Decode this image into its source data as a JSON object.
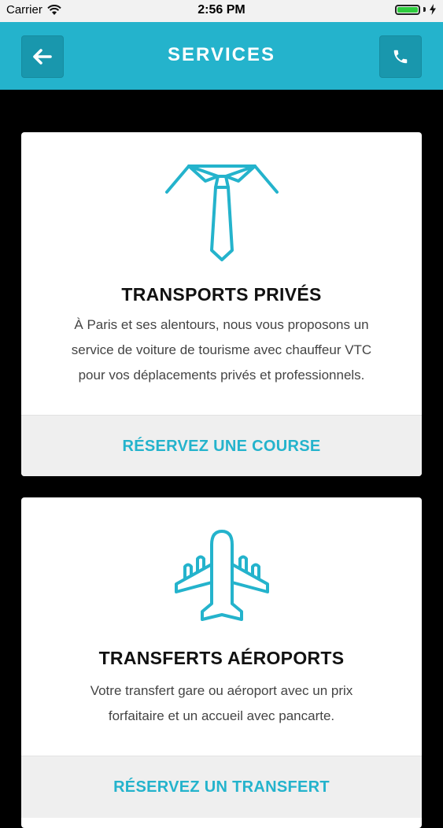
{
  "status_bar": {
    "carrier": "Carrier",
    "time": "2:56 PM",
    "battery_level": 1.0
  },
  "nav": {
    "title": "SERVICES",
    "back_icon": "arrow-left-icon",
    "call_icon": "phone-icon"
  },
  "colors": {
    "accent": "#24b3cc",
    "accent_dark": "#1997ad",
    "card_footer_bg": "#efefef"
  },
  "services": [
    {
      "icon": "necktie-icon",
      "title": "TRANSPORTS PRIVÉS",
      "description_lines": [
        "À Paris et ses alentours, nous vous proposons un",
        "service de voiture de tourisme avec chauffeur VTC",
        "pour vos déplacements privés et professionnels."
      ],
      "action": "RÉSERVEZ UNE COURSE"
    },
    {
      "icon": "airplane-icon",
      "title": "TRANSFERTS AÉROPORTS",
      "description_lines": [
        "Votre transfert gare ou aéroport avec un prix",
        "forfaitaire et un accueil avec pancarte."
      ],
      "action": "RÉSERVEZ UN TRANSFERT"
    }
  ]
}
